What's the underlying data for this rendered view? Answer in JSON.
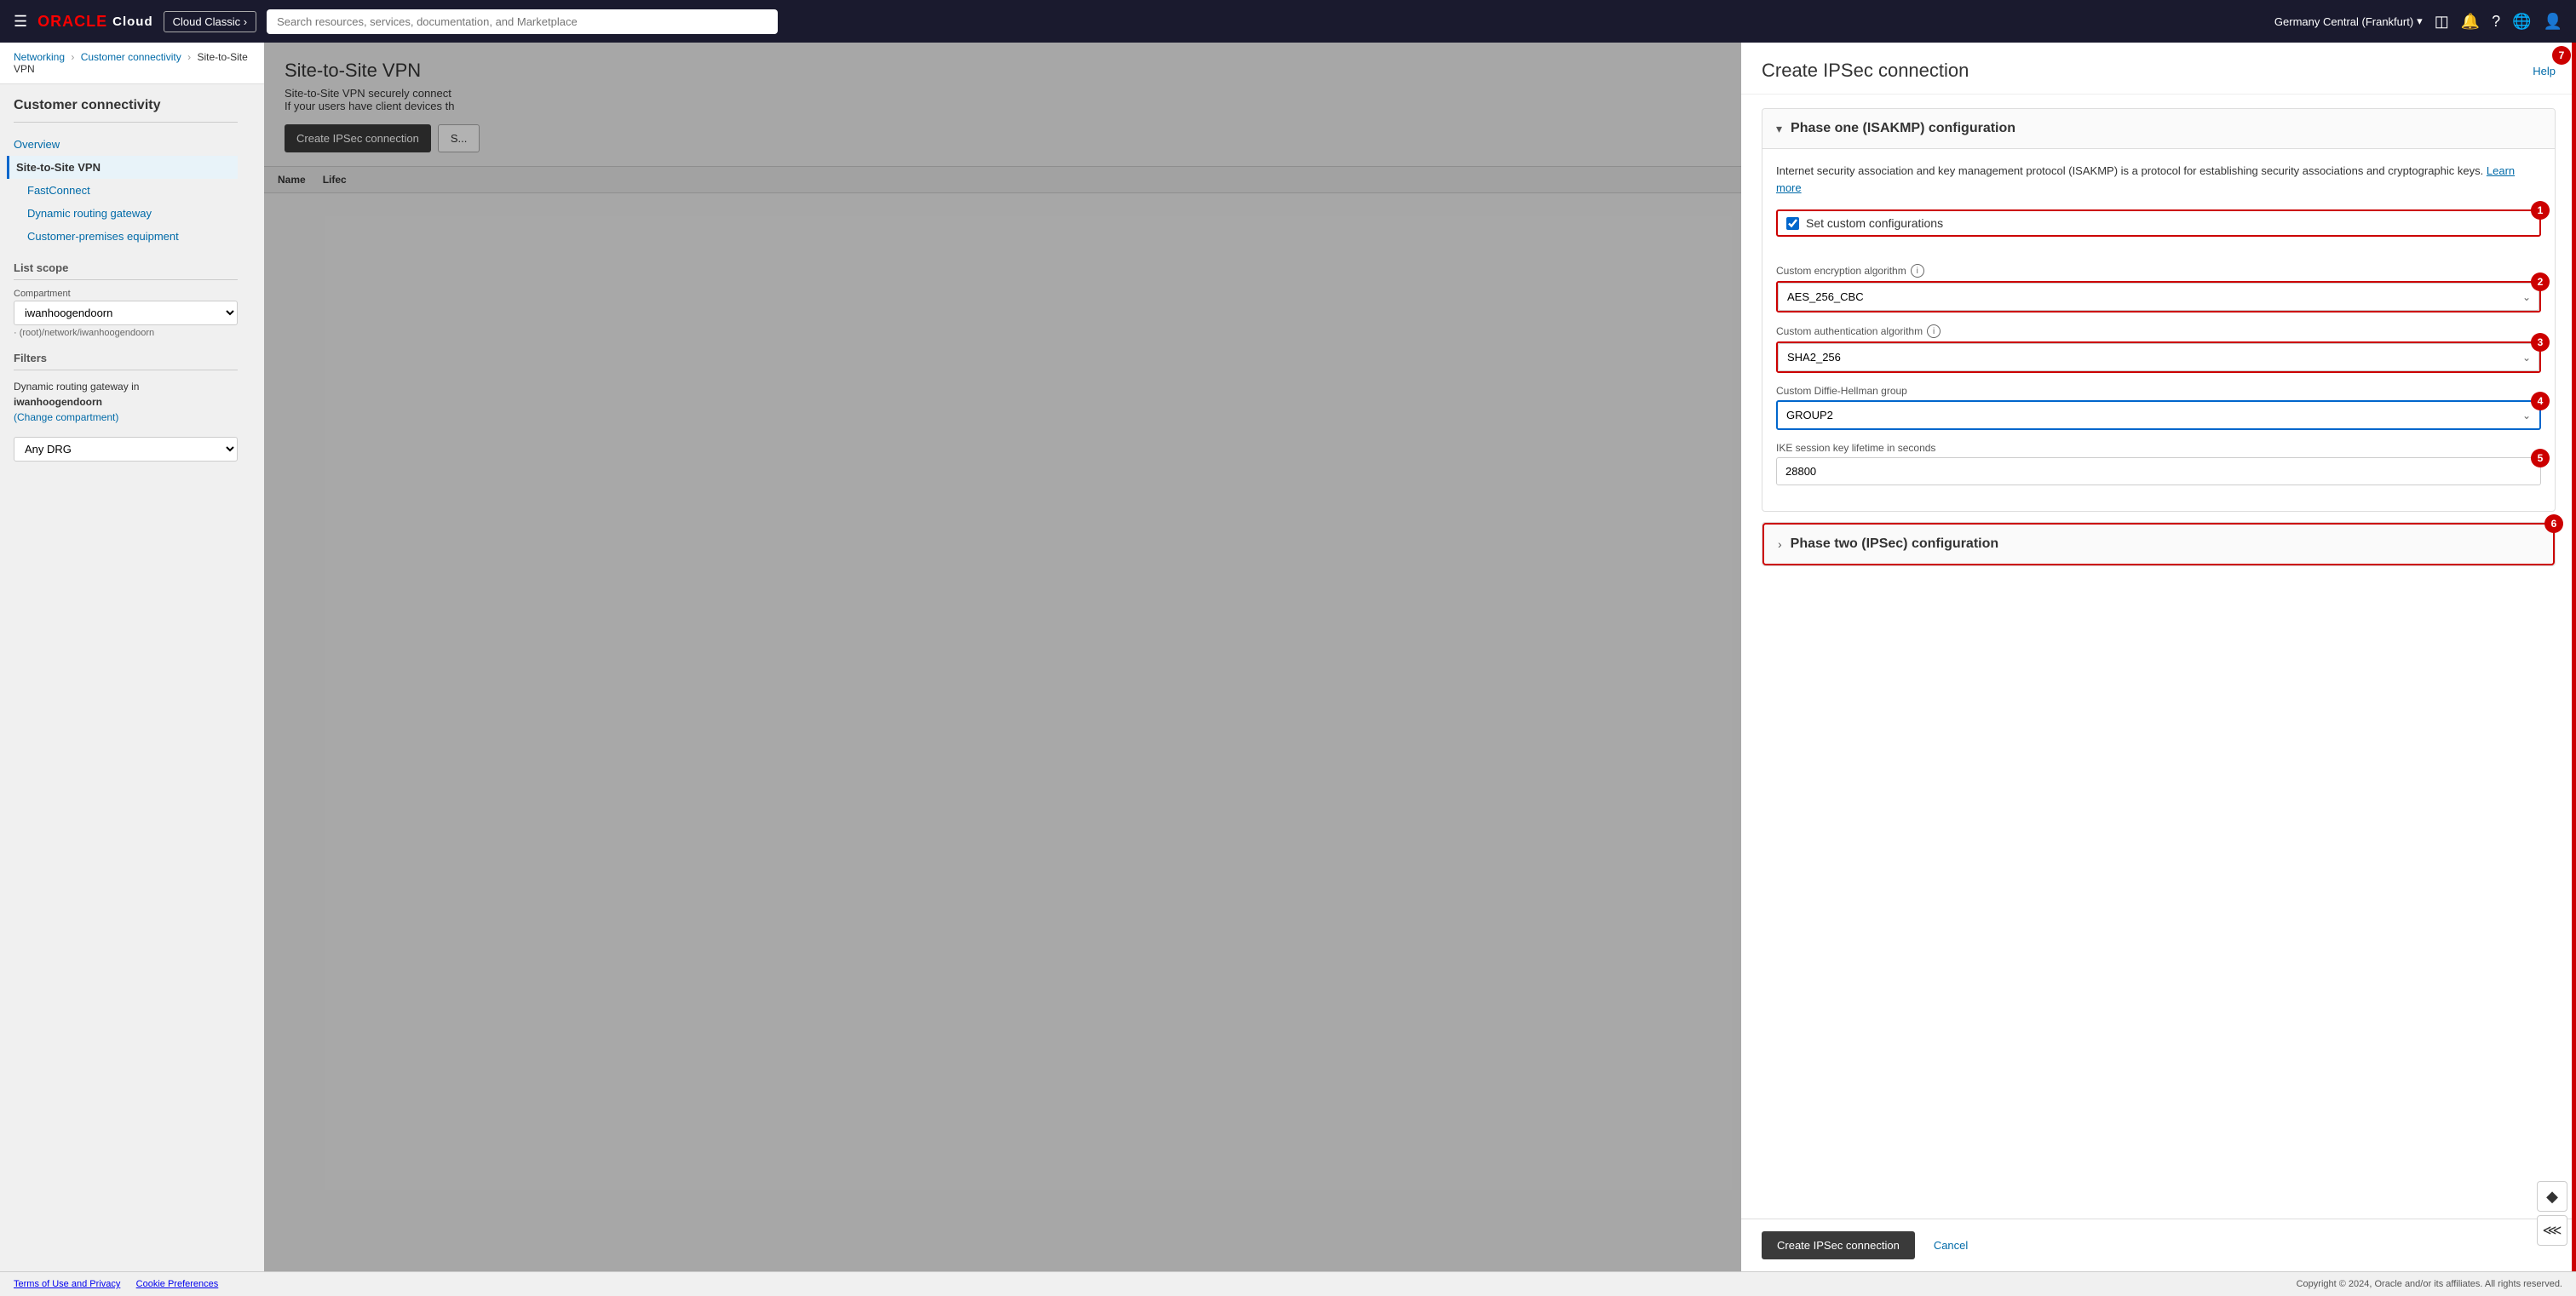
{
  "nav": {
    "menu_icon": "☰",
    "oracle_text": "ORACLE",
    "cloud_text": "Cloud",
    "cloud_classic_btn": "Cloud Classic ›",
    "search_placeholder": "Search resources, services, documentation, and Marketplace",
    "region": "Germany Central (Frankfurt)",
    "icons": {
      "monitor": "⬛",
      "bell": "🔔",
      "question": "?",
      "globe": "🌐",
      "user": "👤"
    }
  },
  "breadcrumb": {
    "networking": "Networking",
    "customer_connectivity": "Customer connectivity",
    "site_to_site_vpn": "Site-to-Site VPN"
  },
  "sidebar": {
    "title": "Customer connectivity",
    "nav_items": [
      {
        "label": "Overview",
        "active": false
      },
      {
        "label": "Site-to-Site VPN",
        "active": true
      },
      {
        "label": "FastConnect",
        "active": false,
        "sub": true
      },
      {
        "label": "Dynamic routing gateway",
        "active": false,
        "sub": true
      },
      {
        "label": "Customer-premises equipment",
        "active": false,
        "sub": true
      }
    ],
    "list_scope": "List scope",
    "compartment_label": "Compartment",
    "compartment_value": "iwanhoogendoorn",
    "compartment_path": "(root)/network/iwanhoogendoorn",
    "filters_label": "Filters",
    "drg_info_line1": "Dynamic routing gateway in",
    "drg_info_bold": "iwanhoogendoorn",
    "drg_change_link": "(Change compartment)",
    "drg_select_value": "Any DRG"
  },
  "vpn": {
    "title": "Site-to-Site VPN",
    "description": "Site-to-Site VPN securely connect",
    "description2": "If your users have client devices th",
    "create_btn": "Create IPSec connection",
    "table_cols": [
      "Name",
      "Lifeс"
    ]
  },
  "modal": {
    "title": "Create IPSec connection",
    "help_label": "Help",
    "phase1": {
      "title": "Phase one (ISAKMP) configuration",
      "expanded": true,
      "desc_text": "Internet security association and key management protocol (ISAKMP) is a protocol for establishing security associations and cryptographic keys.",
      "learn_more_text": "Learn more",
      "set_custom_label": "Set custom configurations",
      "badge1": "1",
      "encryption_label": "Custom encryption algorithm",
      "encryption_value": "AES_256_CBC",
      "badge2": "2",
      "auth_label": "Custom authentication algorithm",
      "auth_value": "SHA2_256",
      "badge3": "3",
      "dh_label": "Custom Diffie-Hellman group",
      "dh_value": "GROUP2",
      "badge4": "4",
      "ike_label": "IKE session key lifetime in seconds",
      "ike_value": "28800",
      "badge5": "5"
    },
    "phase2": {
      "title": "Phase two (IPSec) configuration",
      "expanded": false,
      "badge6": "6"
    },
    "badge7": "7",
    "create_btn": "Create IPSec connection",
    "cancel_btn": "Cancel"
  },
  "footer": {
    "left": "Terms of Use and Privacy    Cookie Preferences",
    "right": "Copyright © 2024, Oracle and/or its affiliates. All rights reserved."
  }
}
